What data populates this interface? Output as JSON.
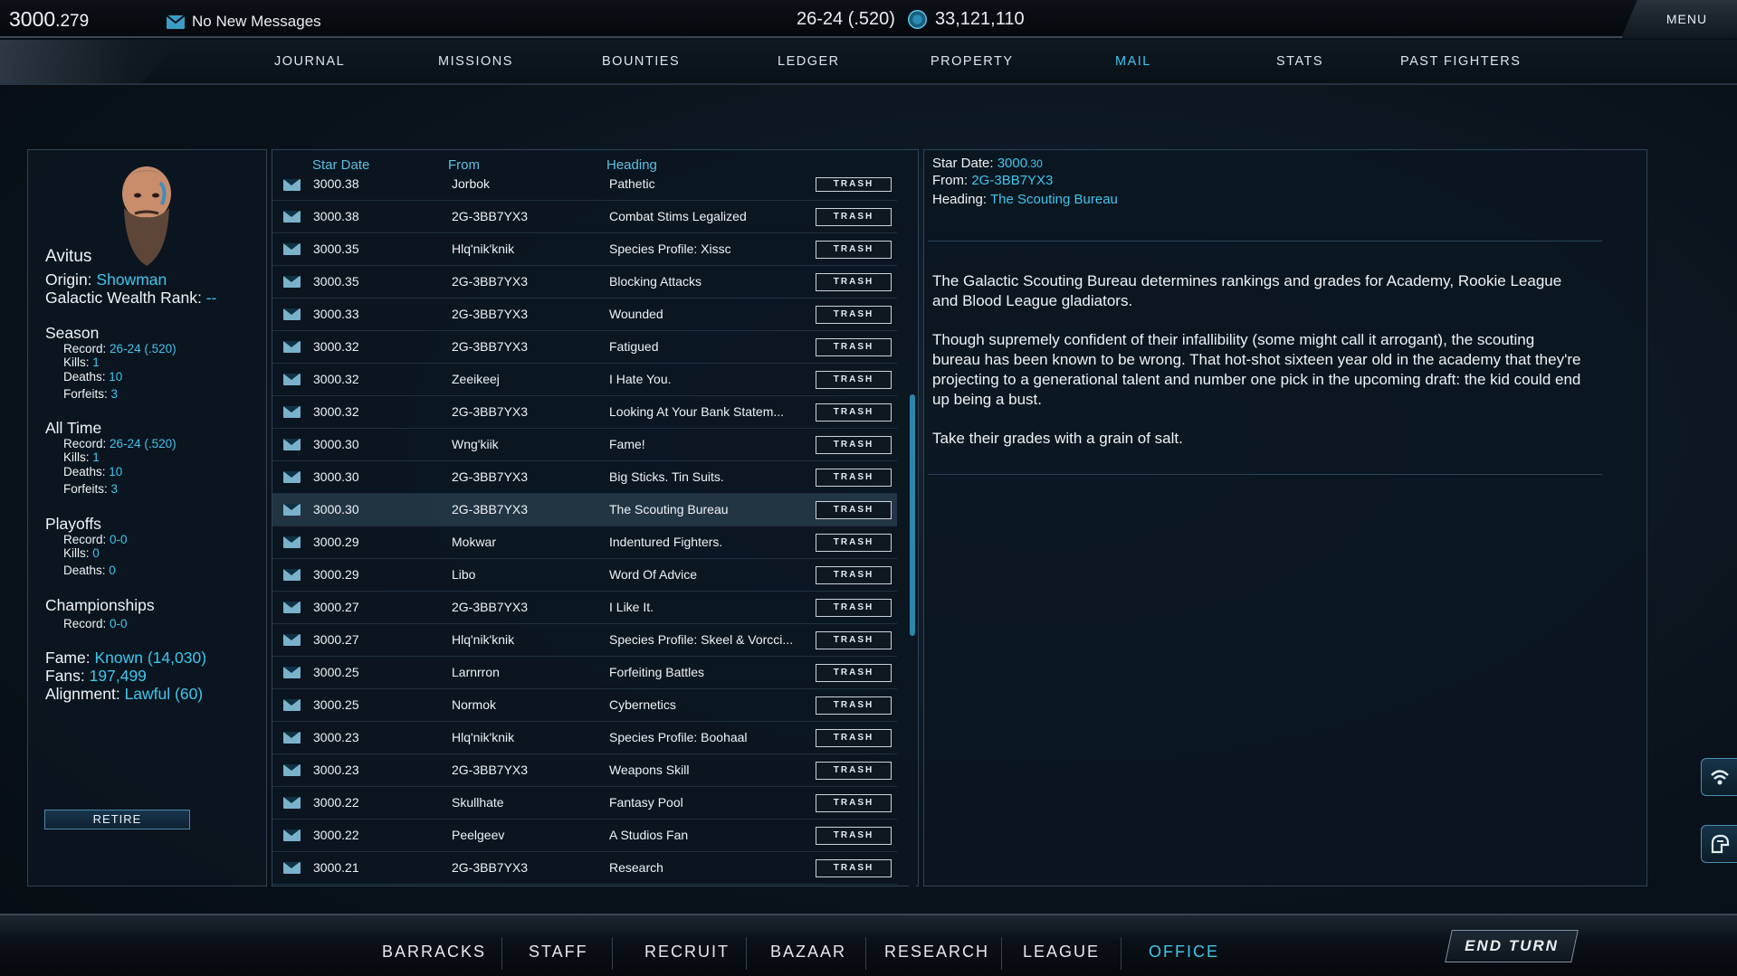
{
  "topbar": {
    "star_date_main": "3000",
    "star_date_frac": ".279",
    "messages": "No New Messages",
    "record": "26-24 (.520)",
    "credits": "33,121,110",
    "menu": "MENU"
  },
  "nav": {
    "tabs": [
      "JOURNAL",
      "MISSIONS",
      "BOUNTIES",
      "LEDGER",
      "PROPERTY",
      "MAIL",
      "STATS",
      "PAST FIGHTERS"
    ],
    "active": "MAIL"
  },
  "profile": {
    "name": "Avitus",
    "origin_label": "Origin:",
    "origin": "Showman",
    "wealth_label": "Galactic Wealth Rank:",
    "wealth": "--",
    "season": {
      "title": "Season",
      "record_label": "Record:",
      "record": "26-24 (.520)",
      "kills_label": "Kills:",
      "kills": "1",
      "deaths_label": "Deaths:",
      "deaths": "10",
      "forfeits_label": "Forfeits:",
      "forfeits": "3"
    },
    "alltime": {
      "title": "All Time",
      "record_label": "Record:",
      "record": "26-24 (.520)",
      "kills_label": "Kills:",
      "kills": "1",
      "deaths_label": "Deaths:",
      "deaths": "10",
      "forfeits_label": "Forfeits:",
      "forfeits": "3"
    },
    "playoffs": {
      "title": "Playoffs",
      "record_label": "Record:",
      "record": "0-0",
      "kills_label": "Kills:",
      "kills": "0",
      "deaths_label": "Deaths:",
      "deaths": "0"
    },
    "championships": {
      "title": "Championships",
      "record_label": "Record:",
      "record": "0-0"
    },
    "fame_label": "Fame:",
    "fame": "Known (14,030)",
    "fans_label": "Fans:",
    "fans": "197,499",
    "alignment_label": "Alignment:",
    "alignment": "Lawful (60)",
    "retire": "RETIRE"
  },
  "mail": {
    "headers": {
      "date": "Star Date",
      "from": "From",
      "heading": "Heading"
    },
    "trash_label": "TRASH",
    "rows": [
      {
        "date": "3000.38",
        "from": "Jorbok",
        "heading": "Pathetic"
      },
      {
        "date": "3000.38",
        "from": "2G-3BB7YX3",
        "heading": "Combat Stims Legalized"
      },
      {
        "date": "3000.35",
        "from": "Hlq'nik'knik",
        "heading": "Species Profile: Xissc"
      },
      {
        "date": "3000.35",
        "from": "2G-3BB7YX3",
        "heading": "Blocking Attacks"
      },
      {
        "date": "3000.33",
        "from": "2G-3BB7YX3",
        "heading": "Wounded"
      },
      {
        "date": "3000.32",
        "from": "2G-3BB7YX3",
        "heading": "Fatigued"
      },
      {
        "date": "3000.32",
        "from": "Zeeikeej",
        "heading": "I Hate You."
      },
      {
        "date": "3000.32",
        "from": "2G-3BB7YX3",
        "heading": "Looking At Your Bank Statem..."
      },
      {
        "date": "3000.30",
        "from": "Wng'kiik",
        "heading": "Fame!"
      },
      {
        "date": "3000.30",
        "from": "2G-3BB7YX3",
        "heading": "Big Sticks. Tin Suits."
      },
      {
        "date": "3000.30",
        "from": "2G-3BB7YX3",
        "heading": "The Scouting Bureau",
        "selected": true
      },
      {
        "date": "3000.29",
        "from": "Mokwar",
        "heading": "Indentured Fighters."
      },
      {
        "date": "3000.29",
        "from": "Libo",
        "heading": "Word Of Advice"
      },
      {
        "date": "3000.27",
        "from": "2G-3BB7YX3",
        "heading": "I Like It."
      },
      {
        "date": "3000.27",
        "from": "Hlq'nik'knik",
        "heading": "Species Profile: Skeel & Vorcci..."
      },
      {
        "date": "3000.25",
        "from": "Larnrron",
        "heading": "Forfeiting Battles"
      },
      {
        "date": "3000.25",
        "from": "Normok",
        "heading": "Cybernetics"
      },
      {
        "date": "3000.23",
        "from": "Hlq'nik'knik",
        "heading": "Species Profile: Boohaal"
      },
      {
        "date": "3000.23",
        "from": "2G-3BB7YX3",
        "heading": "Weapons Skill"
      },
      {
        "date": "3000.22",
        "from": "Skullhate",
        "heading": "Fantasy Pool"
      },
      {
        "date": "3000.22",
        "from": "Peelgeev",
        "heading": "A Studios Fan"
      },
      {
        "date": "3000.21",
        "from": "2G-3BB7YX3",
        "heading": "Research"
      }
    ]
  },
  "detail": {
    "date_label": "Star Date:",
    "date_main": "3000",
    "date_frac": ".30",
    "from_label": "From:",
    "from": "2G-3BB7YX3",
    "heading_label": "Heading:",
    "heading": "The Scouting Bureau",
    "p1": "The Galactic Scouting Bureau determines rankings and grades for Academy, Rookie League and Blood League gladiators.",
    "p2": "Though supremely confident of their infallibility (some might call it arrogant), the scouting bureau has been known to be wrong. That hot-shot sixteen year old in the academy that they're projecting to a generational talent and number one pick in the upcoming draft: the kid could end up being a bust.",
    "p3": "Take their grades with a grain of salt."
  },
  "bottom": {
    "tabs": [
      "BARRACKS",
      "STAFF",
      "RECRUIT",
      "BAZAAR",
      "RESEARCH",
      "LEAGUE",
      "OFFICE"
    ],
    "active": "OFFICE",
    "end_turn": "END TURN"
  },
  "side_icons": [
    "signal-icon",
    "helmet-icon"
  ],
  "colors": {
    "accent": "#3fc6ee",
    "panel_border": "#2e4556",
    "bg": "#0a141d"
  }
}
